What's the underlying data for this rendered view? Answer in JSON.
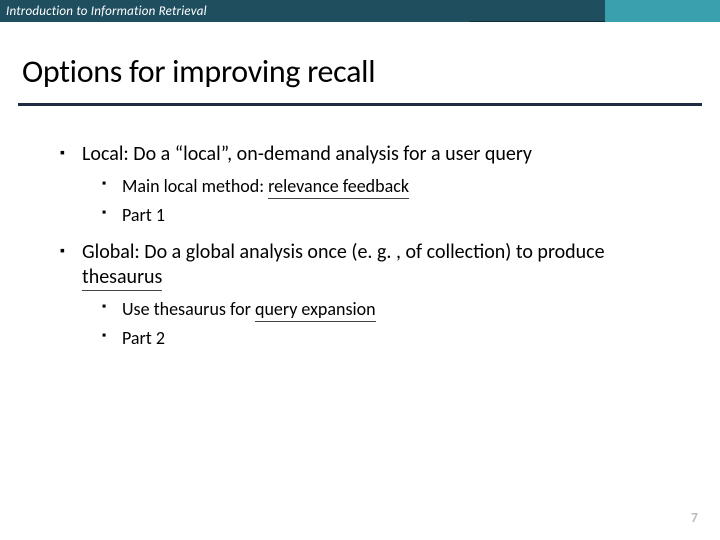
{
  "header": {
    "course": "Introduction to Information Retrieval"
  },
  "title": "Options for improving recall",
  "bullets": {
    "b1": {
      "pre": "Local: Do a “local”, on-demand analysis for a user query",
      "sub": {
        "s1_pre": "Main local method: ",
        "s1_key": "relevance feedback",
        "s2": "Part 1"
      }
    },
    "b2": {
      "pre": "Global: Do a global analysis once (e. g. , of collection) to produce ",
      "key": "thesaurus",
      "sub": {
        "s1_pre": "Use thesaurus for ",
        "s1_key": "query expansion",
        "s2": "Part 2"
      }
    }
  },
  "page": "7"
}
